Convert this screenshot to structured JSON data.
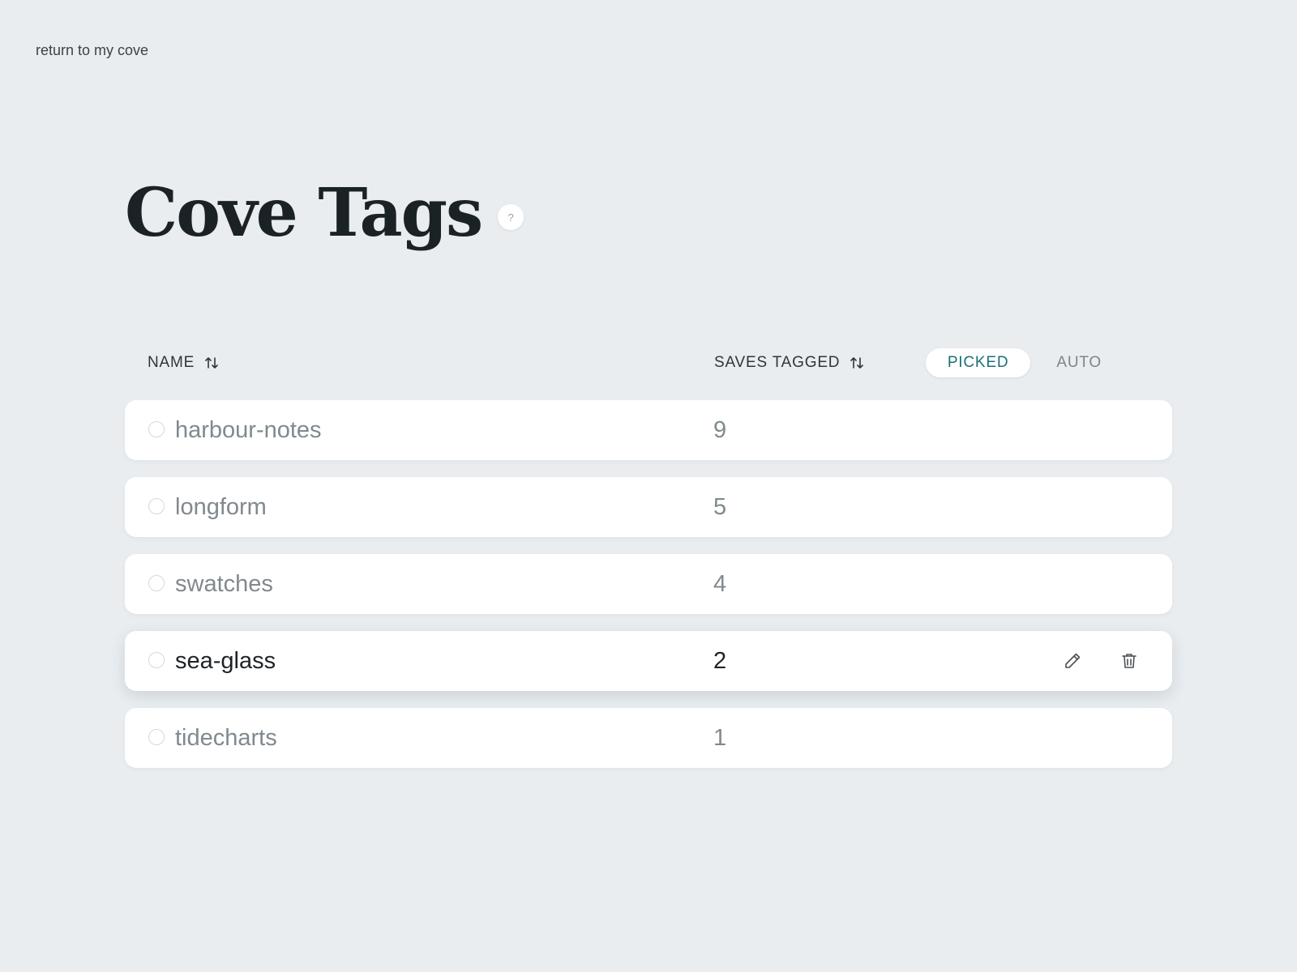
{
  "nav": {
    "back_link": "return to my cove"
  },
  "page": {
    "title": "Cove Tags",
    "help_label": "?"
  },
  "table": {
    "headers": {
      "name": "NAME",
      "saves": "SAVES TAGGED"
    },
    "filter": {
      "options": [
        "PICKED",
        "AUTO"
      ],
      "selected": "PICKED"
    },
    "rows": [
      {
        "name": "harbour-notes",
        "count": "9"
      },
      {
        "name": "longform",
        "count": "5"
      },
      {
        "name": "swatches",
        "count": "4"
      },
      {
        "name": "sea-glass",
        "count": "2",
        "hovered": true
      },
      {
        "name": "tidecharts",
        "count": "1"
      }
    ]
  },
  "icons": {
    "sort": "sort-arrows-icon",
    "edit": "pencil-icon",
    "delete": "trash-icon",
    "select": "radio-circle-icon"
  },
  "colors": {
    "background": "#e9edf0",
    "accent": "#1c6f78",
    "muted_text": "#80898e",
    "strong_text": "#1d2428"
  }
}
